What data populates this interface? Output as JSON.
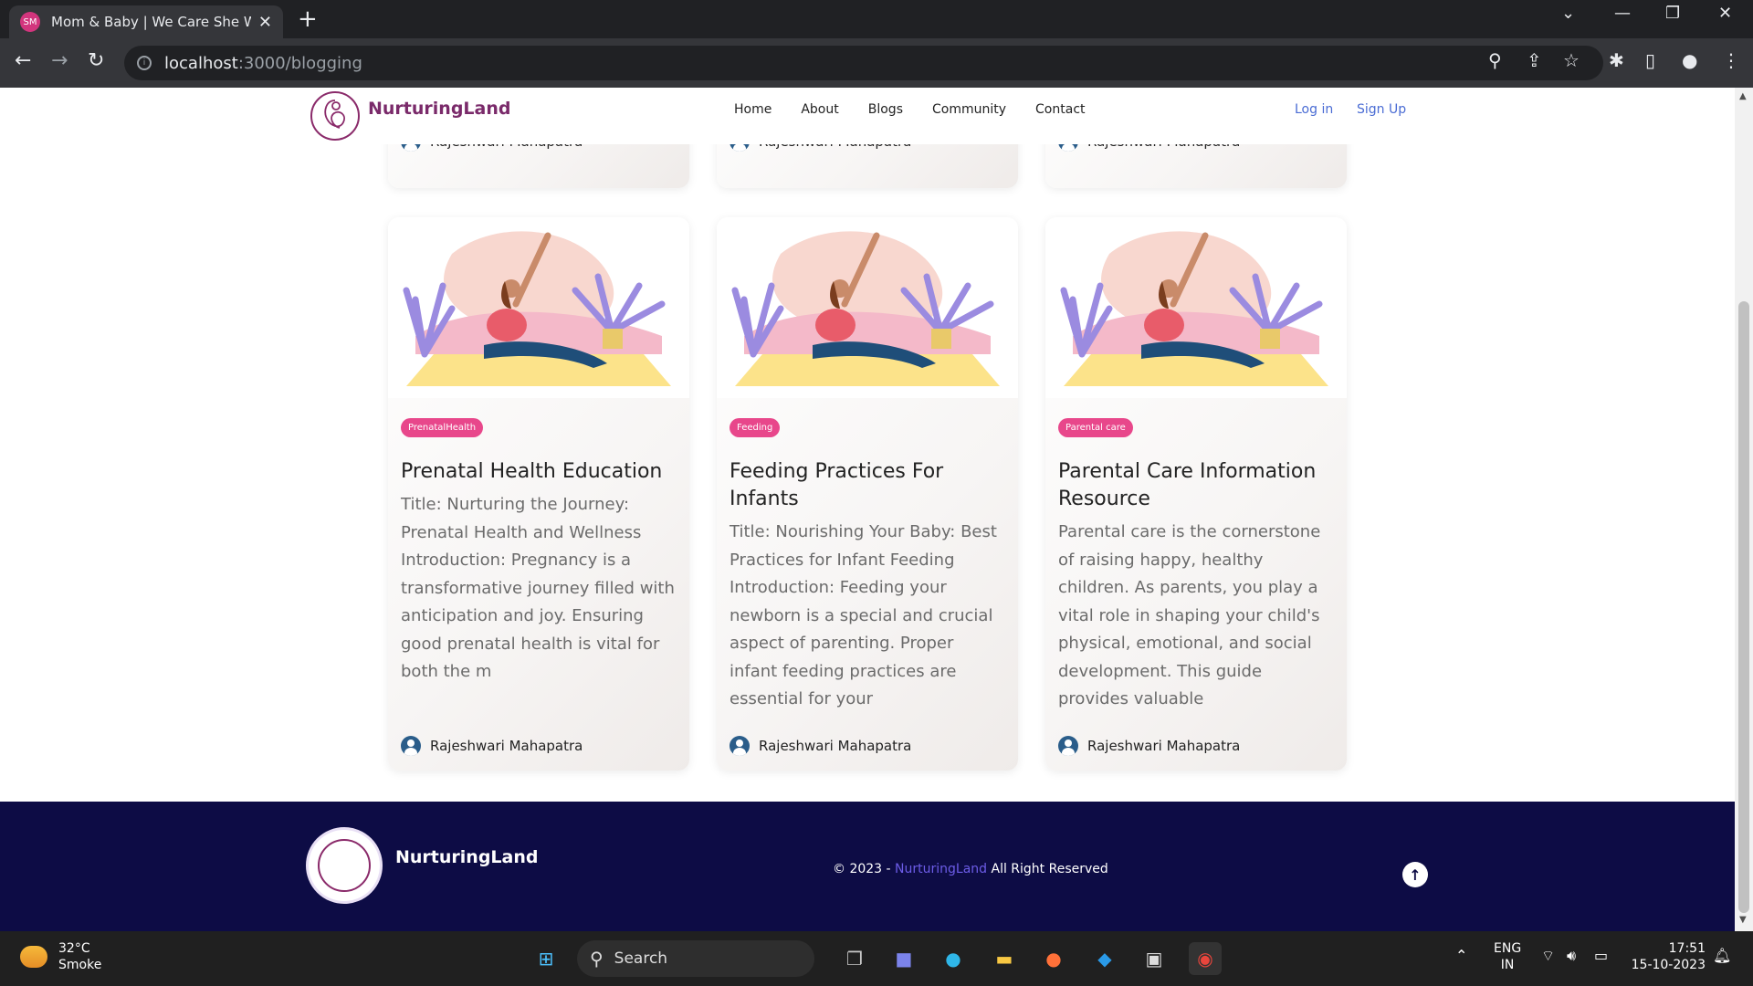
{
  "browser": {
    "tab_title": "Mom & Baby | We Care She Win",
    "favicon_text": "SM",
    "url_host": "localhost",
    "url_path": ":3000/blogging"
  },
  "header": {
    "brand": "NurturingLand",
    "nav": [
      "Home",
      "About",
      "Blogs",
      "Community",
      "Contact"
    ],
    "login": "Log in",
    "signup": "Sign Up"
  },
  "top_cards": [
    {
      "author": "Rajeshwari Mahapatra"
    },
    {
      "author": "Rajeshwari Mahapatra"
    },
    {
      "author": "Rajeshwari Mahapatra"
    }
  ],
  "cards": [
    {
      "tag": "PrenatalHealth",
      "title": "Prenatal Health Education",
      "excerpt": "Title: Nurturing the Journey: Prenatal Health and Wellness Introduction: Pregnancy is a transformative journey filled with anticipation and joy. Ensuring good prenatal health is vital for both the m",
      "author": "Rajeshwari Mahapatra"
    },
    {
      "tag": "Feeding",
      "title": "Feeding Practices For Infants",
      "excerpt": "Title: Nourishing Your Baby: Best Practices for Infant Feeding Introduction: Feeding your newborn is a special and crucial aspect of parenting. Proper infant feeding practices are essential for your",
      "author": "Rajeshwari Mahapatra"
    },
    {
      "tag": "Parental care",
      "title": "Parental Care Information Resource",
      "excerpt": "Parental care is the cornerstone of raising happy, healthy children. As parents, you play a vital role in shaping your child's physical, emotional, and social development. This guide provides valuable",
      "author": "Rajeshwari Mahapatra"
    }
  ],
  "footer": {
    "brand": "NurturingLand",
    "copyright_prefix": "© 2023 - ",
    "copyright_brand": "NurturingLand",
    "copyright_suffix": " All Right Reserved"
  },
  "taskbar": {
    "temperature": "32°C",
    "weather": "Smoke",
    "search_placeholder": "Search",
    "lang_top": "ENG",
    "lang_bottom": "IN",
    "time": "17:51",
    "date": "15-10-2023"
  },
  "colors": {
    "brand": "#7a2a6a",
    "tag": "#e8478b",
    "footer_bg": "#0d0c45",
    "link": "#4a6cd4"
  }
}
